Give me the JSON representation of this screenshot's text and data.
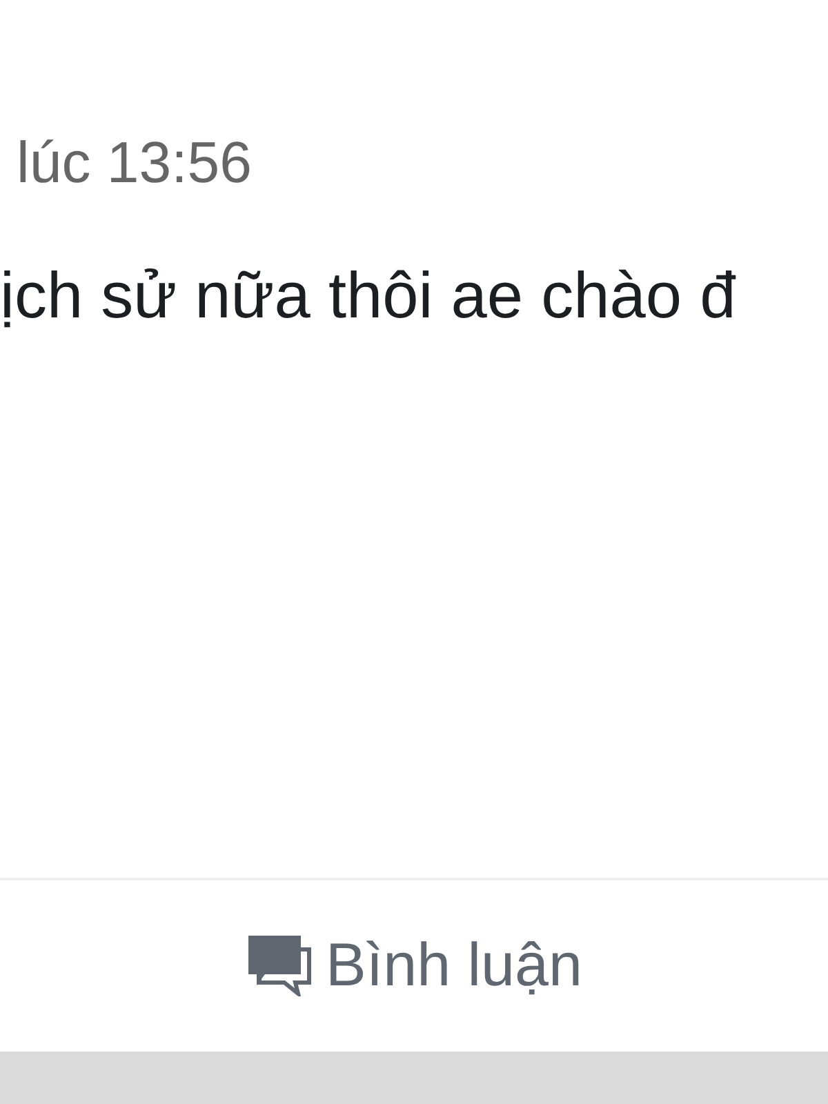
{
  "post": {
    "timestamp": "lúc 13:56",
    "text": "ịch sử nữa thôi ae chào đ"
  },
  "actions": [
    {
      "kind": "comment",
      "label": "Bình luận"
    }
  ]
}
